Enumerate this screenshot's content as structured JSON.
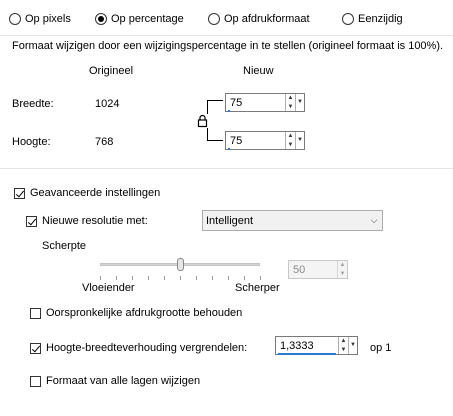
{
  "mode_radios": [
    {
      "label": "Op pixels",
      "selected": false
    },
    {
      "label": "Op percentage",
      "selected": true
    },
    {
      "label": "Op afdrukformaat",
      "selected": false
    },
    {
      "label": "Eenzijdig",
      "selected": false
    }
  ],
  "description": "Formaat wijzigen door een wijzigingspercentage in te stellen (origineel formaat  is 100%).",
  "table": {
    "col_original": "Origineel",
    "col_new": "Nieuw",
    "width_label": "Breedte:",
    "width_original": "1024",
    "width_new": "75",
    "height_label": "Hoogte:",
    "height_original": "768",
    "height_new": "75",
    "lock_icon": "lock-icon"
  },
  "advanced": {
    "label": "Geavanceerde instellingen",
    "checked": true,
    "resolution_label": "Nieuwe resolutie met:",
    "resolution_checked": true,
    "resolution_method": "Intelligent",
    "sharpness": {
      "title": "Scherpte",
      "left_label": "Vloeiender",
      "right_label": "Scherper",
      "value": "50",
      "level": 50
    },
    "keep_print_size": {
      "label": "Oorspronkelijke afdrukgrootte behouden",
      "checked": false
    },
    "lock_aspect": {
      "label": "Hoogte-breedteverhouding vergrendelen:",
      "checked": true,
      "value": "1,3333",
      "suffix": "op 1"
    },
    "all_layers": {
      "label": "Formaat van alle lagen wijzigen",
      "checked": false
    }
  },
  "colors": {
    "accent": "#2a7bd3"
  }
}
